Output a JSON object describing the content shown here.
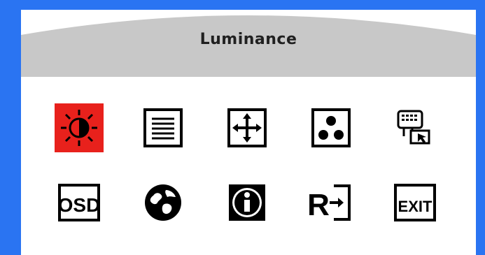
{
  "menu": {
    "title": "Luminance",
    "selected_index": 0,
    "icons": [
      {
        "name": "luminance-icon"
      },
      {
        "name": "image-setup-icon"
      },
      {
        "name": "position-icon"
      },
      {
        "name": "color-icon"
      },
      {
        "name": "input-select-icon"
      },
      {
        "name": "osd-icon",
        "glyph": "OSD"
      },
      {
        "name": "language-icon"
      },
      {
        "name": "information-icon"
      },
      {
        "name": "reset-icon",
        "glyph": "R"
      },
      {
        "name": "exit-icon",
        "glyph": "EXIT"
      }
    ]
  },
  "colors": {
    "frame": "#2a74f2",
    "titlebar": "#c8c8c8",
    "selected": "#e8211c",
    "icon_fg": "#000000"
  }
}
